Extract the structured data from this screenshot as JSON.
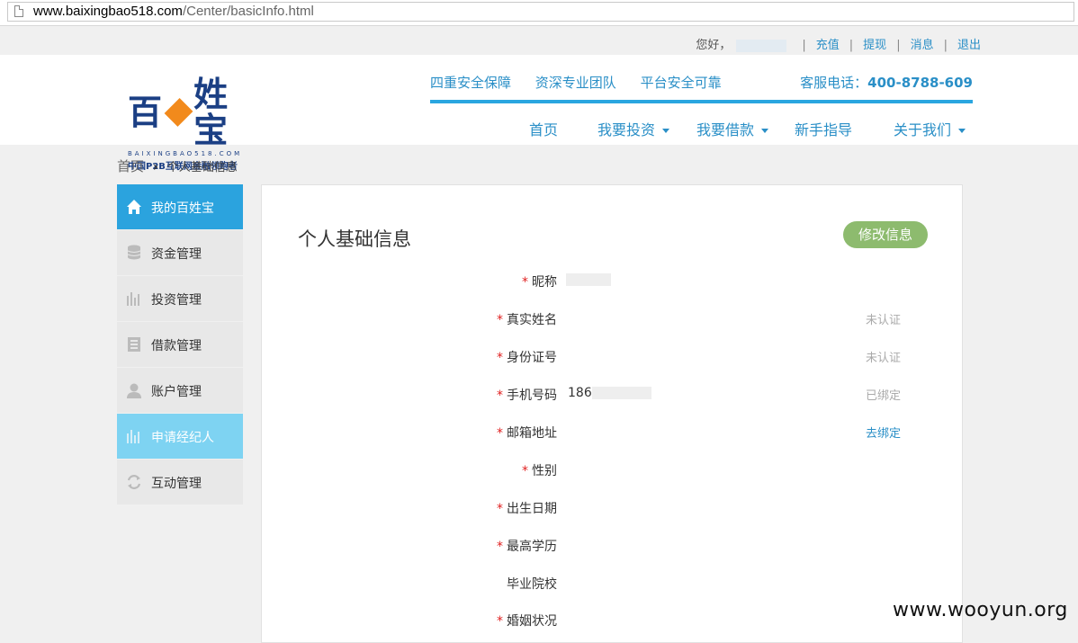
{
  "browser": {
    "url_host": "www.baixingbao518.com",
    "url_path": "/Center/basicInfo.html"
  },
  "topbar": {
    "greeting": "您好，",
    "links": [
      "充值",
      "提现",
      "消息",
      "退出"
    ]
  },
  "logo": {
    "chars": [
      "百",
      "姓宝"
    ],
    "sub": "BAIXINGBAO518.COM",
    "slogan": "中国P2B互联网金融领跑者"
  },
  "header": {
    "features": [
      "四重安全保障",
      "资深专业团队",
      "平台安全可靠"
    ],
    "hotline_label": "客服电话：",
    "hotline_number": "400-8788-609"
  },
  "nav": {
    "items": [
      {
        "label": "首页",
        "dropdown": false
      },
      {
        "label": "我要投资",
        "dropdown": true
      },
      {
        "label": "我要借款",
        "dropdown": true
      },
      {
        "label": "新手指导",
        "dropdown": false
      },
      {
        "label": "关于我们",
        "dropdown": true
      }
    ]
  },
  "breadcrumb": {
    "home": "首页",
    "current": "个人基础信息"
  },
  "sidebar": {
    "items": [
      {
        "label": "我的百姓宝",
        "icon": "home-icon",
        "state": "active"
      },
      {
        "label": "资金管理",
        "icon": "coins-icon",
        "state": "normal"
      },
      {
        "label": "投资管理",
        "icon": "bar-chart-icon",
        "state": "normal"
      },
      {
        "label": "借款管理",
        "icon": "ledger-icon",
        "state": "normal"
      },
      {
        "label": "账户管理",
        "icon": "user-icon",
        "state": "normal"
      },
      {
        "label": "申请经纪人",
        "icon": "bar-chart-icon",
        "state": "highlight"
      },
      {
        "label": "互动管理",
        "icon": "refresh-icon",
        "state": "normal"
      }
    ]
  },
  "main": {
    "title": "个人基础信息",
    "edit_label": "修改信息",
    "fields": [
      {
        "label": "昵称",
        "required": true,
        "value": "",
        "status": ""
      },
      {
        "label": "真实姓名",
        "required": true,
        "value": "",
        "status": "未认证"
      },
      {
        "label": "身份证号",
        "required": true,
        "value": "",
        "status": "未认证"
      },
      {
        "label": "手机号码",
        "required": true,
        "value": "186",
        "status": "已绑定"
      },
      {
        "label": "邮箱地址",
        "required": true,
        "value": "",
        "status": "去绑定"
      },
      {
        "label": "性别",
        "required": true,
        "value": "",
        "status": ""
      },
      {
        "label": "出生日期",
        "required": true,
        "value": "",
        "status": ""
      },
      {
        "label": "最高学历",
        "required": true,
        "value": "",
        "status": ""
      },
      {
        "label": "毕业院校",
        "required": false,
        "value": "",
        "status": ""
      },
      {
        "label": "婚姻状况",
        "required": true,
        "value": "",
        "status": ""
      }
    ]
  },
  "watermark": "www.wooyun.org"
}
